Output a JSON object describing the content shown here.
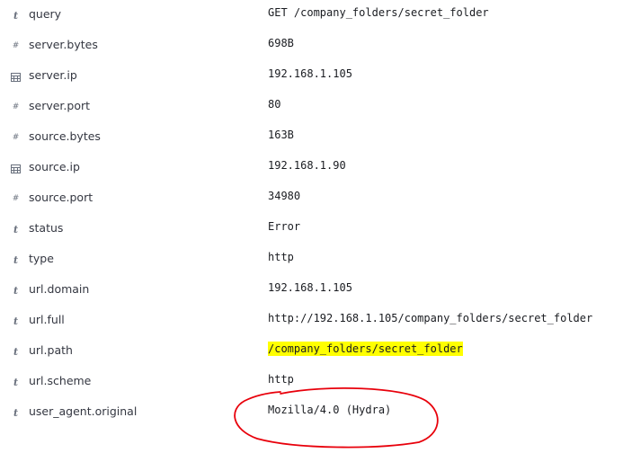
{
  "colors": {
    "icon": "#69707d",
    "field_name": "#343741",
    "value": "#1a1c21",
    "highlight": "#ffff00",
    "annotation": "#e8000b"
  },
  "rows": [
    {
      "type_icon": "string-type-icon",
      "type_glyph": "t",
      "field": "query",
      "value": "GET /company_folders/secret_folder"
    },
    {
      "type_icon": "number-type-icon",
      "type_glyph": "#",
      "field": "server.bytes",
      "value": "698B"
    },
    {
      "type_icon": "ip-type-icon",
      "type_glyph": "",
      "field": "server.ip",
      "value": "192.168.1.105"
    },
    {
      "type_icon": "number-type-icon",
      "type_glyph": "#",
      "field": "server.port",
      "value": "80"
    },
    {
      "type_icon": "number-type-icon",
      "type_glyph": "#",
      "field": "source.bytes",
      "value": "163B"
    },
    {
      "type_icon": "ip-type-icon",
      "type_glyph": "",
      "field": "source.ip",
      "value": "192.168.1.90"
    },
    {
      "type_icon": "number-type-icon",
      "type_glyph": "#",
      "field": "source.port",
      "value": "34980"
    },
    {
      "type_icon": "string-type-icon",
      "type_glyph": "t",
      "field": "status",
      "value": "Error"
    },
    {
      "type_icon": "string-type-icon",
      "type_glyph": "t",
      "field": "type",
      "value": "http"
    },
    {
      "type_icon": "string-type-icon",
      "type_glyph": "t",
      "field": "url.domain",
      "value": "192.168.1.105"
    },
    {
      "type_icon": "string-type-icon",
      "type_glyph": "t",
      "field": "url.full",
      "value": "http://192.168.1.105/company_folders/secret_folder"
    },
    {
      "type_icon": "string-type-icon",
      "type_glyph": "t",
      "field": "url.path",
      "value": "/company_folders/secret_folder",
      "highlighted": true
    },
    {
      "type_icon": "string-type-icon",
      "type_glyph": "t",
      "field": "url.scheme",
      "value": "http"
    },
    {
      "type_icon": "string-type-icon",
      "type_glyph": "t",
      "field": "user_agent.original",
      "value": "Mozilla/4.0 (Hydra)"
    }
  ]
}
